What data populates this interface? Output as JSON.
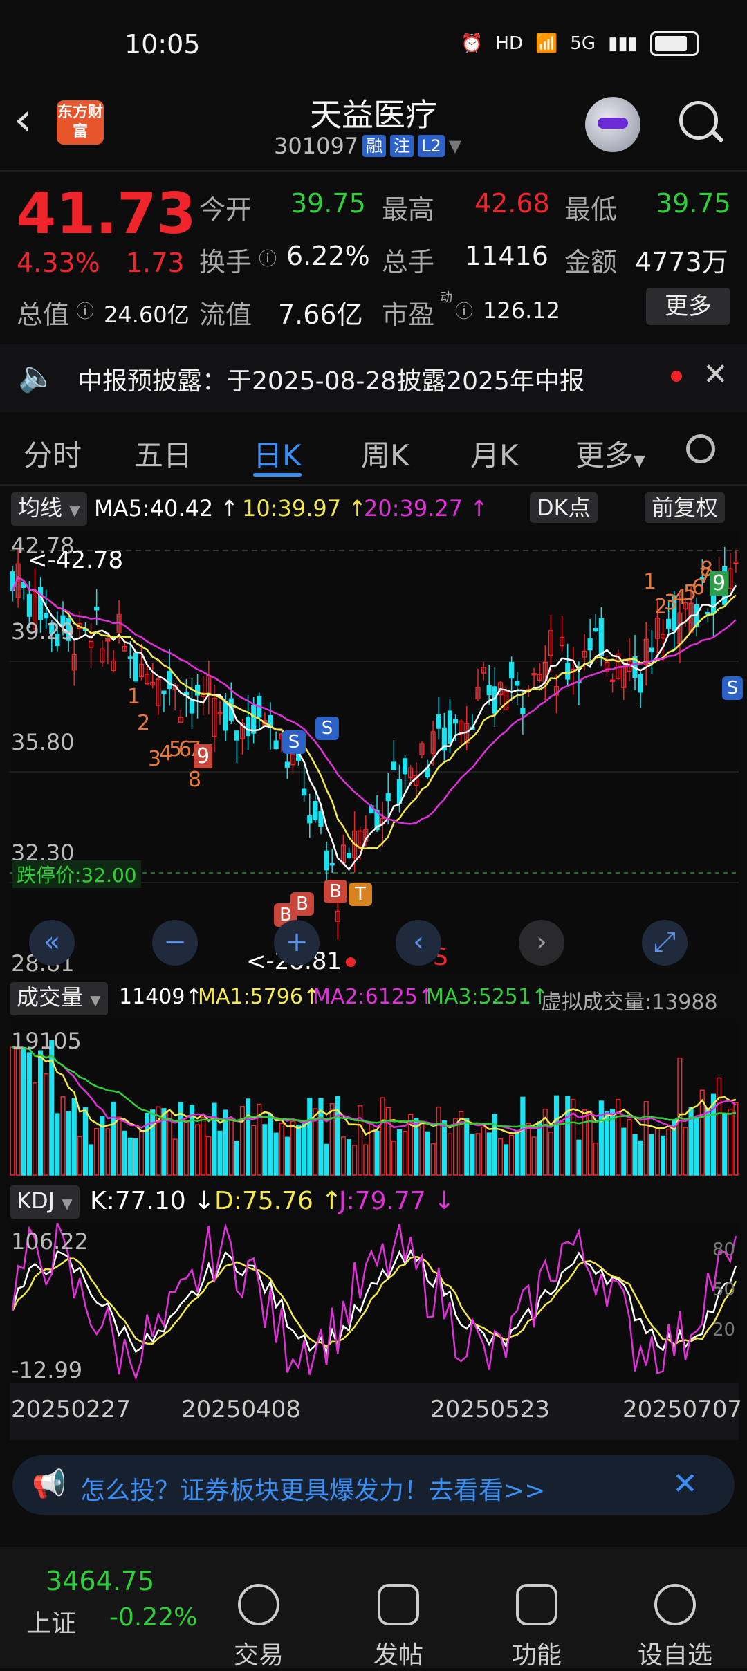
{
  "status_bar": {
    "time": "10:05",
    "icons": [
      "alarm-icon",
      "hd-icon",
      "wifi-icon",
      "5g-signal-icon",
      "battery-icon"
    ],
    "hd_label": "HD",
    "net_label": "5G"
  },
  "header": {
    "app_logo_text": "东方财富",
    "stock_name": "天益医疗",
    "stock_code": "301097",
    "tags": [
      "融",
      "注",
      "L2"
    ]
  },
  "quote": {
    "price": "41.73",
    "change_pct": "4.33%",
    "change_amt": "1.73",
    "open_label": "今开",
    "open": "39.75",
    "high_label": "最高",
    "high": "42.68",
    "low_label": "最低",
    "low": "39.75",
    "turnover_label": "换手",
    "turnover": "6.22%",
    "volume_label": "总手",
    "volume": "11416",
    "amount_label": "金额",
    "amount": "4773万",
    "total_value_label": "总值",
    "total_value": "24.60亿",
    "float_value_label": "流值",
    "float_value": "7.66亿",
    "pe_label": "市盈",
    "pe_sup": "动",
    "pe": "126.12",
    "more_label": "更多"
  },
  "notice": {
    "text": "中报预披露：于2025-08-28披露2025年中报"
  },
  "tabs": [
    {
      "label": "分时"
    },
    {
      "label": "五日"
    },
    {
      "label": "日K",
      "active": true
    },
    {
      "label": "周K"
    },
    {
      "label": "月K"
    },
    {
      "label": "更多"
    }
  ],
  "kline": {
    "indicator_label": "均线",
    "ma5": "MA5:40.42",
    "ma10": "10:39.97",
    "ma20": "20:39.27",
    "dk_label": "DK点",
    "adjust_label": "前复权",
    "y_labels": [
      "42.78",
      "39.29",
      "35.80",
      "32.30",
      "28.81"
    ],
    "high_marker": "<-42.78",
    "low_marker": "<-28.81",
    "limit_down_label": "跌停价:32.00",
    "signal_s": "S",
    "signal_b": "B",
    "signal_t": "T",
    "seq_numbers_low": [
      "1",
      "2",
      "3",
      "4",
      "5",
      "6",
      "7",
      "8",
      "9"
    ],
    "seq_numbers_high": [
      "1",
      "2",
      "3",
      "4",
      "5",
      "6",
      "7",
      "8",
      "9"
    ],
    "controls": [
      "«",
      "−",
      "+",
      "‹",
      "›",
      "⤢"
    ]
  },
  "volume": {
    "label": "成交量",
    "current": "11409",
    "ma1": "MA1:5796",
    "ma2": "MA2:6125",
    "ma3": "MA3:5251",
    "virtual": "虚拟成交量:13988",
    "max_label": "19105"
  },
  "kdj": {
    "label": "KDJ",
    "k": "K:77.10",
    "d": "D:75.76",
    "j": "J:79.77",
    "max_label": "106.22",
    "min_label": "-12.99",
    "levels": [
      "80",
      "50",
      "20"
    ]
  },
  "x_axis": [
    "20250227",
    "20250408",
    "20250523",
    "20250707"
  ],
  "banner": {
    "text": "怎么投？证券板块更具爆发力！去看看>>"
  },
  "bottom_bar": {
    "index_value": "3464.75",
    "index_name": "上证",
    "index_change": "-0.22%",
    "items": [
      {
        "label": "交易"
      },
      {
        "label": "发帖"
      },
      {
        "label": "功能"
      },
      {
        "label": "设自选"
      }
    ]
  },
  "colors": {
    "up": "#f0252b",
    "down": "#2fcf3a",
    "accent": "#3b8ef3",
    "ma5": "#ffffff",
    "ma10": "#f5e94a",
    "ma20": "#e030d8",
    "candle_down": "#19e3f0"
  }
}
